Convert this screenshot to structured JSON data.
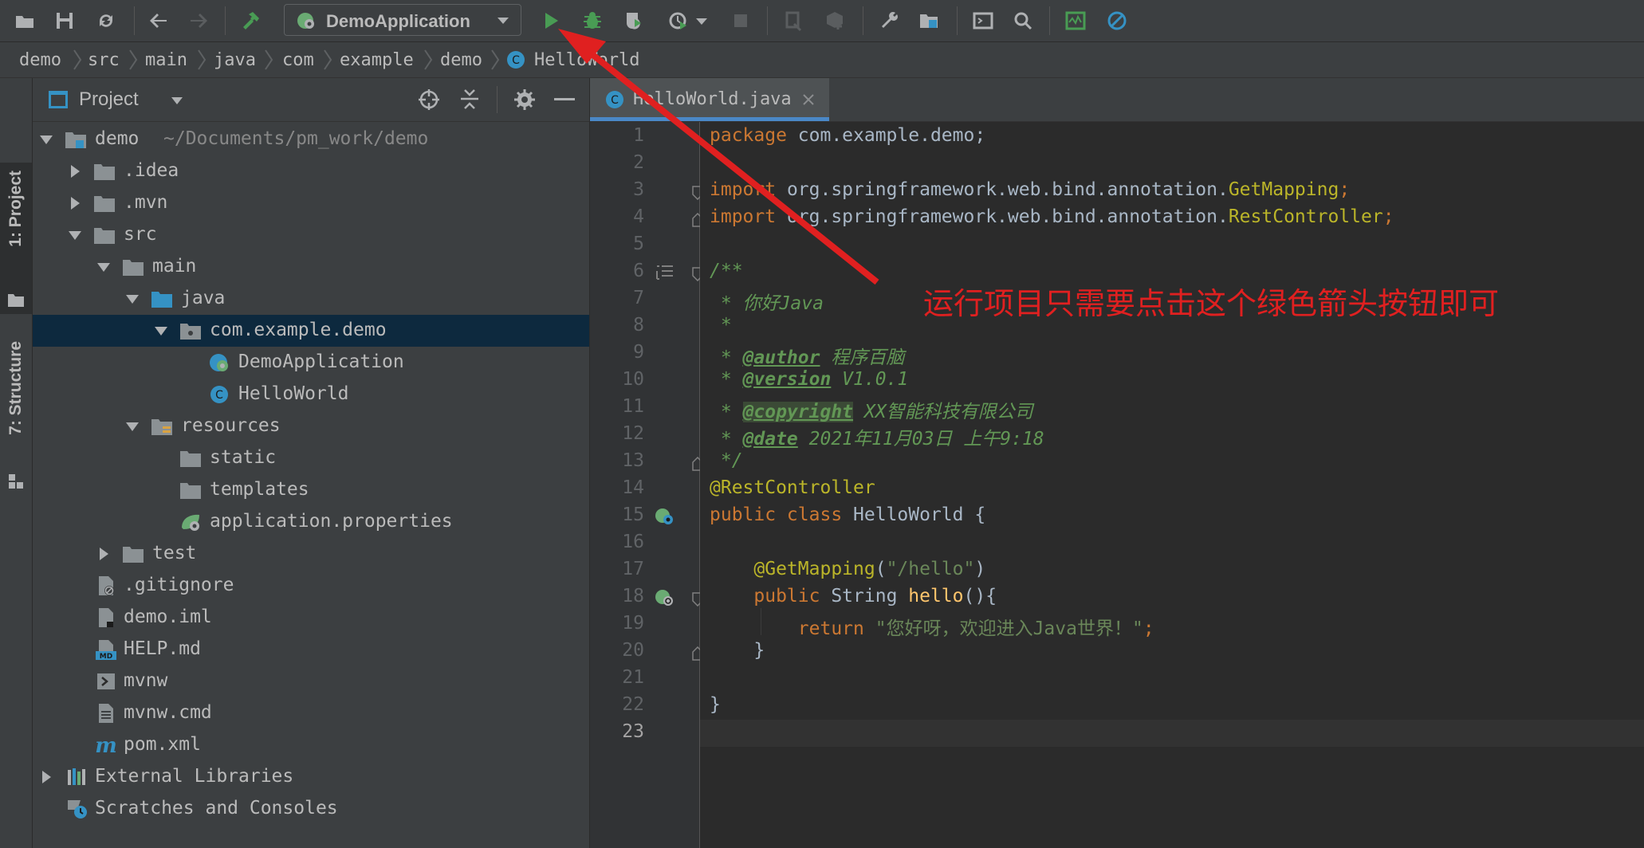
{
  "toolbar": {
    "run_config_label": "DemoApplication"
  },
  "breadcrumb": [
    "demo",
    "src",
    "main",
    "java",
    "com",
    "example",
    "demo",
    "HelloWorld"
  ],
  "tool_strip": {
    "project_label": "1: Project",
    "structure_label": "7: Structure"
  },
  "project": {
    "title": "Project",
    "root_label": "demo",
    "root_path": "~/Documents/pm_work/demo",
    "items": [
      {
        "label": ".idea"
      },
      {
        "label": ".mvn"
      },
      {
        "label": "src"
      },
      {
        "label": "main"
      },
      {
        "label": "java"
      },
      {
        "label": "com.example.demo"
      },
      {
        "label": "DemoApplication"
      },
      {
        "label": "HelloWorld"
      },
      {
        "label": "resources"
      },
      {
        "label": "static"
      },
      {
        "label": "templates"
      },
      {
        "label": "application.properties"
      },
      {
        "label": "test"
      },
      {
        "label": ".gitignore"
      },
      {
        "label": "demo.iml"
      },
      {
        "label": "HELP.md"
      },
      {
        "label": "mvnw"
      },
      {
        "label": "mvnw.cmd"
      },
      {
        "label": "pom.xml"
      },
      {
        "label": "External Libraries"
      },
      {
        "label": "Scratches and Consoles"
      }
    ]
  },
  "editor": {
    "tab_label": "HelloWorld.java",
    "line_numbers": [
      "1",
      "2",
      "3",
      "4",
      "5",
      "6",
      "7",
      "8",
      "9",
      "10",
      "11",
      "12",
      "13",
      "14",
      "15",
      "16",
      "17",
      "18",
      "19",
      "20",
      "21",
      "22",
      "23"
    ],
    "code": {
      "l1_kw": "package",
      "l1_rest": " com.example.demo;",
      "l3_kw": "import",
      "l3_pkg": " org.springframework.web.bind.annotation.",
      "l3_cls": "GetMapping",
      "l3_semi": ";",
      "l4_kw": "import",
      "l4_pkg": " org.springframework.web.bind.annotation.",
      "l4_cls": "RestController",
      "l4_semi": ";",
      "l6": "/**",
      "l7": " * 你好Java",
      "l8": " *",
      "l9_star": " * ",
      "l9_tag": "@author",
      "l9_val": " 程序百脑",
      "l10_star": " * ",
      "l10_tag": "@version",
      "l10_val": " V1.0.1",
      "l11_star": " * ",
      "l11_tag": "@copyright",
      "l11_val": " XX智能科技有限公司",
      "l12_star": " * ",
      "l12_tag": "@date",
      "l12_val": " 2021年11月03日 上午9:18",
      "l13": " */",
      "l14": "@RestController",
      "l15_kw": "public class",
      "l15_rest": " HelloWorld {",
      "l17_ann": "    @GetMapping",
      "l17_p1": "(",
      "l17_str": "\"/hello\"",
      "l17_p2": ")",
      "l18_kw": "    public",
      "l18_type": " String ",
      "l18_fn": "hello",
      "l18_rest": "(){",
      "l19_kw": "        return ",
      "l19_str": "\"您好呀，欢迎进入Java世界！\"",
      "l19_semi": ";",
      "l20": "    }",
      "l22": "}"
    }
  },
  "annotation": {
    "text": "运行项目只需要点击这个绿色箭头按钮即可",
    "color": "#e02020"
  },
  "colors": {
    "accent": "#4a88c7",
    "run_green": "#499c54",
    "selection": "#0d293e"
  }
}
